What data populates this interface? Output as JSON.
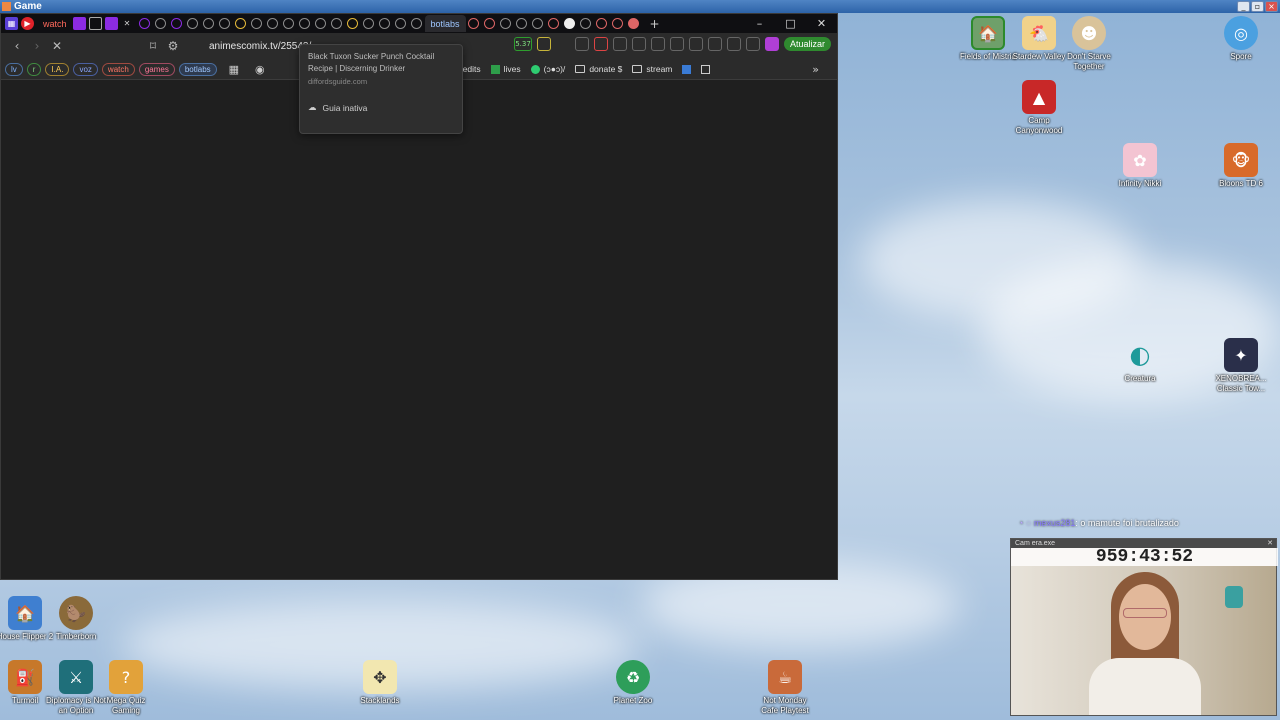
{
  "outer_window": {
    "title": "Game"
  },
  "browser": {
    "tabs": {
      "named": [
        "watch",
        "botlabs"
      ],
      "new_tab": "+"
    },
    "window_controls": [
      "–",
      "□",
      "✕"
    ],
    "address": {
      "url": "animescomix.tv/25543/",
      "update_button": "Atualizar",
      "badge": "5.37"
    },
    "bookmark_chips": [
      "lv",
      "r",
      "I.A.",
      "voz",
      "watch",
      "games",
      "botlabs"
    ],
    "bookmark_items": [
      "edits",
      "lives",
      "(ↄ●ↄ)/",
      "donate $",
      "stream"
    ],
    "popup": {
      "title": "Black Tuxon Sucker Punch Cocktail Recipe | Discerning Drinker",
      "site": "diffordsguide.com",
      "item": "Guia inativa"
    }
  },
  "desktop_icons": [
    {
      "label": "Fields of Mistria"
    },
    {
      "label": "Stardew Valley"
    },
    {
      "label": "Don't Starve Together"
    },
    {
      "label": "Spore"
    },
    {
      "label": "Camp Canyonwood"
    },
    {
      "label": "Infinity Nikki"
    },
    {
      "label": "Bloons TD 6"
    },
    {
      "label": "Creatura"
    },
    {
      "label": "XENOBREA... Classic Tow..."
    },
    {
      "label": "House Flipper 2"
    },
    {
      "label": "Timberborn"
    },
    {
      "label": "Turmoil"
    },
    {
      "label": "Diplomacy is Not an Option"
    },
    {
      "label": "Mega Quiz Gaming"
    },
    {
      "label": "Stacklands"
    },
    {
      "label": "Planet Zoo"
    },
    {
      "label": "Not Monday Cafe Playtest"
    }
  ],
  "chat": {
    "user": "mexus281",
    "message": ": o mamute foi brutalizado"
  },
  "webcam": {
    "title": "Cam era.exe",
    "timer": "959:43:52"
  }
}
